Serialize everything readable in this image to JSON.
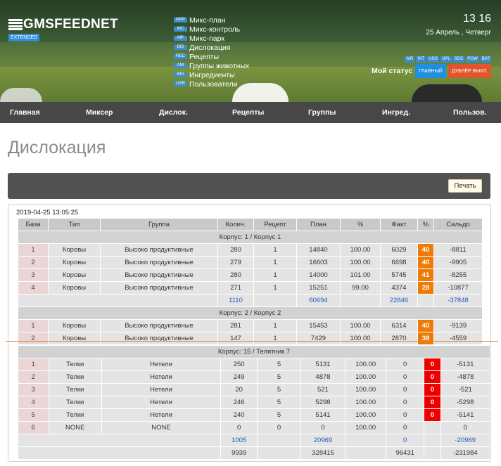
{
  "header": {
    "logo": "GMSFEEDNET",
    "edition": "EXTENDED",
    "time": "13 16",
    "date": "25 Апрель , Четверг",
    "status_label": "Мой статус",
    "status_main": "ГЛАВНЫЙ",
    "status_dup": "ДУБЛЁР ВЫКЛ.",
    "sys_badges": [
      "AIR",
      "INT",
      "USG",
      "UPL",
      "SDC",
      "POW",
      "BAT"
    ],
    "menu": [
      {
        "tag": "MPP",
        "label": "Микс-план"
      },
      {
        "tag": "MC",
        "label": "Микс-контроль"
      },
      {
        "tag": "MP",
        "label": "Микс-парк"
      },
      {
        "tag": "DIS",
        "label": "Дислокация"
      },
      {
        "tag": "REC",
        "label": "Рецепты"
      },
      {
        "tag": "ANI",
        "label": "Группы животных"
      },
      {
        "tag": "ING",
        "label": "Ингредиенты"
      },
      {
        "tag": "USR",
        "label": "Пользователи"
      }
    ]
  },
  "nav": [
    "Главная",
    "Миксер",
    "Дислок.",
    "Рецепты",
    "Группы",
    "Ингред.",
    "Пользов."
  ],
  "page_title": "Дислокация",
  "print_label": "Печать",
  "report": {
    "timestamp": "2019-04-25 13:05:25",
    "columns": [
      "База",
      "Тип",
      "Группа",
      "Колич.",
      "Рецепт",
      "План",
      "%",
      "Факт",
      "%",
      "Сальдо"
    ],
    "block1": {
      "group1_title": "Корпус: 1 / Корпус 1",
      "rows1": [
        [
          "1",
          "Коровы",
          "Высоко продуктивные",
          "280",
          "1",
          "14840",
          "100.00",
          "6029",
          "40",
          "-8811"
        ],
        [
          "2",
          "Коровы",
          "Высоко продуктивные",
          "279",
          "1",
          "16603",
          "100.00",
          "6698",
          "40",
          "-9905"
        ],
        [
          "3",
          "Коровы",
          "Высоко продуктивные",
          "280",
          "1",
          "14000",
          "101.00",
          "5745",
          "41",
          "-8255"
        ],
        [
          "4",
          "Коровы",
          "Высоко продуктивные",
          "271",
          "1",
          "15251",
          "99.00",
          "4374",
          "28",
          "-10877"
        ]
      ],
      "total1": [
        "1110",
        "60694",
        "22846",
        "-37848"
      ],
      "group2_title": "Корпус: 2 / Корпус 2",
      "rows2": [
        [
          "1",
          "Коровы",
          "Высоко продуктивные",
          "281",
          "1",
          "15453",
          "100.00",
          "6314",
          "40",
          "-9139"
        ],
        [
          "2",
          "Коровы",
          "Высоко продуктивные",
          "147",
          "1",
          "7429",
          "100.00",
          "2870",
          "38",
          "-4559"
        ]
      ]
    },
    "block2": {
      "group_title": "Корпус: 15 / Телятник 7",
      "rows": [
        [
          "1",
          "Телки",
          "Нетели",
          "250",
          "5",
          "5131",
          "100.00",
          "0",
          "0",
          "-5131"
        ],
        [
          "2",
          "Телки",
          "Нетели",
          "249",
          "5",
          "4878",
          "100.00",
          "0",
          "0",
          "-4878"
        ],
        [
          "3",
          "Телки",
          "Нетели",
          "20",
          "5",
          "521",
          "100.00",
          "0",
          "0",
          "-521"
        ],
        [
          "4",
          "Телки",
          "Нетели",
          "246",
          "5",
          "5298",
          "100.00",
          "0",
          "0",
          "-5298"
        ],
        [
          "5",
          "Телки",
          "Нетели",
          "240",
          "5",
          "5141",
          "100.00",
          "0",
          "0",
          "-5141"
        ],
        [
          "6",
          "NONE",
          "NONE",
          "0",
          "0",
          "0",
          "100.00",
          "0",
          "",
          "0"
        ]
      ],
      "total": [
        "1005",
        "20969",
        "0",
        "-20969"
      ],
      "grand_total": [
        "9939",
        "328415",
        "96431",
        "-231984"
      ]
    }
  },
  "colors": {
    "accent_orange": "#ef7a06",
    "accent_red": "#ee0000",
    "link_blue": "#2559c2",
    "nav_bg": "#474747"
  }
}
